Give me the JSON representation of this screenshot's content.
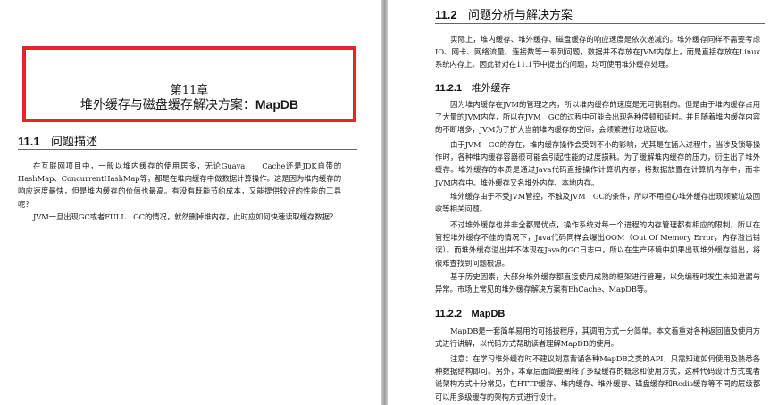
{
  "left_page": {
    "chapter_number": "第11章",
    "chapter_title_prefix": "堆外缓存与磁盘缓存解决方案：",
    "chapter_title_bold": "MapDB",
    "section": {
      "number": "11.1",
      "title": "问题描述"
    },
    "paragraphs": [
      "在互联网项目中，一般以堆内缓存的使用居多，无论Guava　　Cache还是JDK自带的HashMap、ConcurrentHashMap等，都是在堆内缓存中做数据计算操作。这是因为堆内缓存的响应速度最快，但是堆内缓存的价值也最高。有没有既能节约成本，又能提供较好的性能的工具呢？",
      "JVM一旦出现GC或者FULL　GC的情况，就然删掉堆内存，此时应如何快速读取缓存数据？"
    ]
  },
  "right_page": {
    "section": {
      "number": "11.2",
      "title": "问题分析与解决方案"
    },
    "intro": "实际上，堆内缓存、堆外缓存、磁盘缓存的响应速度是依次递减的。堆外缓存同样不需要考虑IO、网卡、网络流量、连接数等一系列问题，数据并不存放在JVM内存上，而是直接存放在Linux系统内存上。因此针对在11.1节中提出的问题，均可使用堆外缓存处理。",
    "sub1": {
      "number": "11.2.1",
      "title": "堆外缓存"
    },
    "sub1_paragraphs": [
      "因为堆内缓存在JVM的管理之内，所以堆内缓存的速度是无可挑剔的。但是由于堆内缓存占用了大量的JVM内存，所以在JVM　GC的过程中可能会出现各种停顿和延时。并且随着堆内缓存内容的不断增多，JVM为了扩大当前堆内缓存的空间，会频繁进行垃圾回收。",
      "由于JVM　GC的存在，堆内缓存操作会受到不小的影响，尤其是在插入过程中，当涉及锁等操作时，各种堆内缓存容器很可能会引起性能的过度损耗。为了缓解堆内缓存的压力，衍生出了堆外缓存。堆外缓存的本质是通过Java代码直接操作计算机内存，将数据放置在计算机内存中，而非JVM内存中。堆外缓存又名堆外内存、本地内存。",
      "堆外缓存由于不受JVM管控，不触及JVM　GC的条件，所以不用担心堆外缓存出现频繁垃圾回收等相关问题。",
      "不过堆外缓存也并非全都是优点，操作系统对每一个进程的内存管理都有相应的限制，所以在管控堆外缓存不佳的情况下，Java代码同样会爆出OOM（Out Of Memory Error，内存溢出错误）。而堆外缓存溢出并不体现在Java的GC日志中，所以在生产环境中如果出现堆外缓存溢出，将很难查找到问题根源。",
      "基于历史因素，大部分堆外缓存都直接使用成熟的框架进行管理，以免编程时发生未知泄漏与异常。市场上常见的堆外缓存解决方案有EhCache、MapDB等。"
    ],
    "sub2": {
      "number": "11.2.2",
      "title": "MapDB"
    },
    "sub2_paragraphs": [
      "MapDB是一套简单易用的可插拔程序，其调用方式十分简单。本文着重对各种返回值及使用方式进行讲解，以代码方式帮助读者理解MapDB的使用。",
      "注意：在学习堆外缓存时不建议刻意背诵各种MapDB之类的API，只需知道如何使用及熟悉各种数据结构即可。另外，本章后面简要阐释了多级缓存的概念和使用方式，这种代码设计方式或者说架构方式十分常见，在HTTP缓存、堆内缓存、堆外缓存、磁盘缓存和Redis缓存等不同的层级都可以用多级缓存的架构方式进行设计。"
    ]
  },
  "colors": {
    "highlight_border": "#e8232a",
    "page_background": "#ffffff",
    "viewer_background": "#a9a9a9"
  }
}
